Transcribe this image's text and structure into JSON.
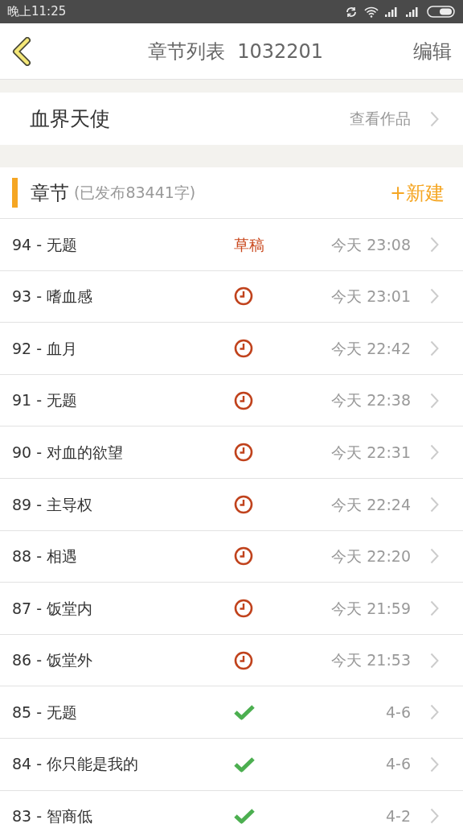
{
  "status_bar": {
    "time": "晚上11:25"
  },
  "nav": {
    "title": "章节列表  1032201",
    "action": "编辑"
  },
  "book": {
    "title": "血界天使",
    "link": "查看作品"
  },
  "section": {
    "title": "章节",
    "count": "(已发布83441字)",
    "action": "+新建"
  },
  "chapters": [
    {
      "title": "94 - 无题",
      "kind": "draft",
      "status": "草稿",
      "time": "今天 23:08"
    },
    {
      "title": "93 - 嗜血感",
      "kind": "scheduled",
      "time": "今天 23:01"
    },
    {
      "title": "92 - 血月",
      "kind": "scheduled",
      "time": "今天 22:42"
    },
    {
      "title": "91 - 无题",
      "kind": "scheduled",
      "time": "今天 22:38"
    },
    {
      "title": "90 - 对血的欲望",
      "kind": "scheduled",
      "time": "今天 22:31"
    },
    {
      "title": "89 - 主导权",
      "kind": "scheduled",
      "time": "今天 22:24"
    },
    {
      "title": "88 - 相遇",
      "kind": "scheduled",
      "time": "今天 22:20"
    },
    {
      "title": "87 - 饭堂内",
      "kind": "scheduled",
      "time": "今天 21:59"
    },
    {
      "title": "86 - 饭堂外",
      "kind": "scheduled",
      "time": "今天 21:53"
    },
    {
      "title": "85 - 无题",
      "kind": "published",
      "time": "4-6"
    },
    {
      "title": "84 - 你只能是我的",
      "kind": "published",
      "time": "4-6"
    },
    {
      "title": "83 - 智商低",
      "kind": "published",
      "time": "4-2"
    }
  ]
}
